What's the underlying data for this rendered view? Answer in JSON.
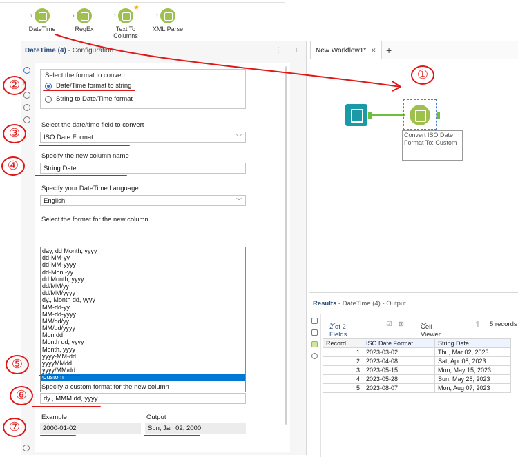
{
  "palette": {
    "tools": [
      {
        "label": "DateTime",
        "icon": "datetime-icon"
      },
      {
        "label": "RegEx",
        "icon": "regex-icon"
      },
      {
        "label": "Text To\nColumns",
        "icon": "text-to-columns-icon",
        "starred": true
      },
      {
        "label": "XML Parse",
        "icon": "xml-parse-icon"
      }
    ]
  },
  "config": {
    "title_tool": "DateTime (4)",
    "title_suffix": " - Configuration",
    "more_icon": "⋮",
    "pin_icon": "📌",
    "format_group_label": "Select the format to convert",
    "radio_to_string": "Date/Time format to string",
    "radio_to_datetime": "String to Date/Time format",
    "field_label": "Select the date/time field to convert",
    "field_value": "ISO Date Format",
    "new_column_label": "Specify the new column name",
    "new_column_value": "String Date",
    "language_label": "Specify your DateTime Language",
    "language_value": "English",
    "format_list_label": "Select the format for the new column",
    "formats": [
      "day, dd Month, yyyy",
      "dd-MM-yy",
      "dd-MM-yyyy",
      "dd-Mon.-yy",
      "dd Month, yyyy",
      "dd/MM/yy",
      "dd/MM/yyyy",
      "dy., Month dd, yyyy",
      "MM-dd-yy",
      "MM-dd-yyyy",
      "MM/dd/yy",
      "MM/dd/yyyy",
      "Mon dd",
      "Month dd, yyyy",
      "Month, yyyy",
      "yyyy-MM-dd",
      "yyyyMMdd",
      "yyyy/MM/dd",
      "Custom"
    ],
    "selected_format": "Custom",
    "custom_label": "Specify a custom format for the new column",
    "custom_value": "dy., MMM dd, yyyy",
    "example_label": "Example",
    "example_value": "2000-01-02",
    "output_label": "Output",
    "output_value": "Sun, Jan 02, 2000"
  },
  "annotations": [
    "①",
    "②",
    "③",
    "④",
    "⑤",
    "⑥",
    "⑦"
  ],
  "workflow": {
    "tab_label": "New Workflow1*",
    "tab_close": "✕",
    "add_tab": "+",
    "node_annotation": "Convert ISO Date Format To: Custom"
  },
  "results": {
    "title_main": "Results",
    "title_suffix": " - DateTime (4) - Output",
    "fields_selector": "2 of 2 Fields",
    "cell_viewer": "Cell Viewer",
    "record_count": "5 records",
    "columns": [
      "Record",
      "ISO Date Format",
      "String Date"
    ],
    "rows": [
      [
        "1",
        "2023-03-02",
        "Thu, Mar 02, 2023"
      ],
      [
        "2",
        "2023-04-08",
        "Sat, Apr 08, 2023"
      ],
      [
        "3",
        "2023-05-15",
        "Mon, May 15, 2023"
      ],
      [
        "4",
        "2023-05-28",
        "Sun, May 28, 2023"
      ],
      [
        "5",
        "2023-08-07",
        "Mon, Aug 07, 2023"
      ]
    ]
  },
  "colors": {
    "accent": "#2f6fd1",
    "annotation_red": "#e01818",
    "tool_green": "#9fbf4e",
    "input_teal": "#1a9aa6",
    "selection_blue": "#0078d4"
  }
}
